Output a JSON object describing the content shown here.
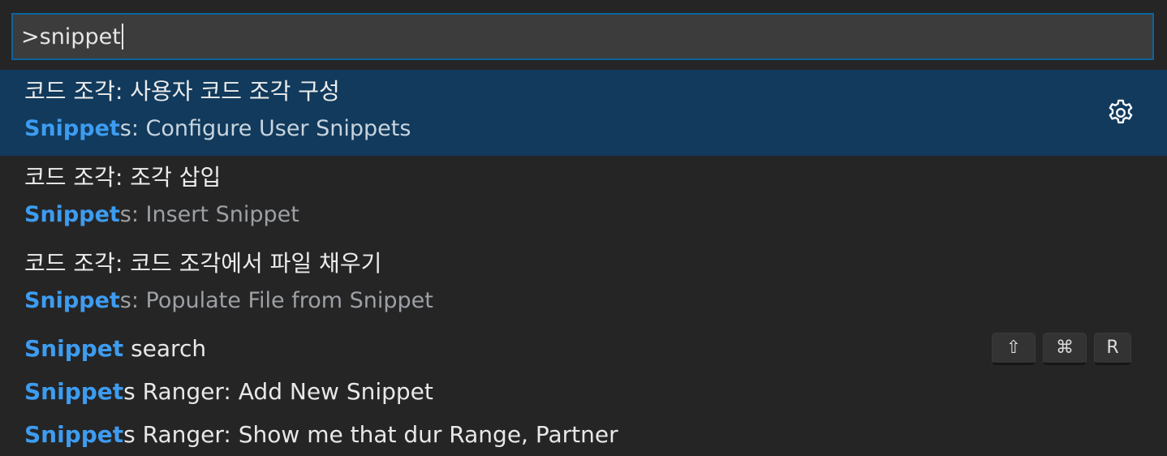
{
  "search": {
    "value": ">snippet"
  },
  "items": [
    {
      "label_ko": "코드 조각: 사용자 코드 조각 구성",
      "detail_match": "Snippet",
      "detail_rest": "s: Configure User Snippets",
      "selected": true,
      "icon": "gear-icon"
    },
    {
      "label_ko": "코드 조각: 조각 삽입",
      "detail_match": "Snippet",
      "detail_rest": "s: Insert Snippet"
    },
    {
      "label_ko": "코드 조각: 코드 조각에서 파일 채우기",
      "detail_match": "Snippet",
      "detail_rest": "s: Populate File from Snippet"
    },
    {
      "match": "Snippet",
      "rest": " search",
      "keybinding": [
        "⇧",
        "⌘",
        "R"
      ]
    },
    {
      "match": "Snippet",
      "rest": "s Ranger: Add New Snippet"
    },
    {
      "match": "Snippet",
      "rest": "s Ranger: Show me that dur Range, Partner"
    }
  ],
  "colors": {
    "background": "#252526",
    "input_border": "#0e639c",
    "selected_row": "#113a5c",
    "highlight": "#3d9cf0"
  }
}
